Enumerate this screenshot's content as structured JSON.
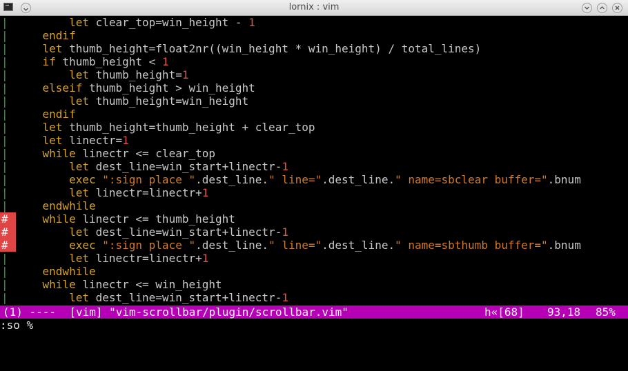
{
  "window": {
    "title": "lornix : vim",
    "app_icon": "terminal-icon",
    "menu_icon": "window-menu-icon",
    "buttons": [
      "minimize-icon",
      "maximize-icon",
      "close-icon"
    ],
    "titlebar_color": "#e6e6e6"
  },
  "editor": {
    "sign_column": [
      "|",
      "|",
      "|",
      "|",
      "|",
      "|",
      "|",
      "|",
      "|",
      "|",
      "|",
      "|",
      "|",
      "|",
      "|",
      "#",
      "#",
      "#",
      "|",
      "|",
      "|",
      "|"
    ],
    "lines": [
      "        let clear_top=win_height - 1",
      "    endif",
      "    let thumb_height=float2nr((win_height * win_height) / total_lines)",
      "    if thumb_height < 1",
      "        let thumb_height=1",
      "    elseif thumb_height > win_height",
      "        let thumb_height=win_height",
      "    endif",
      "    let thumb_height=thumb_height + clear_top",
      "    let linectr=1",
      "    while linectr <= clear_top",
      "        let dest_line=win_start+linectr-1",
      "        exec \":sign place \".dest_line.\" line=\".dest_line.\" name=sbclear buffer=\".bnum",
      "        let linectr=linectr+1",
      "    endwhile",
      "    while linectr <= thumb_height",
      "        let dest_line=win_start+linectr-1",
      "        exec \":sign place \".dest_line.\" line=\".dest_line.\" name=sbthumb buffer=\".bnum",
      "        let linectr=linectr+1",
      "    endwhile",
      "    while linectr <= win_height",
      "        let dest_line=win_start+linectr-1"
    ],
    "colors": {
      "keyword": "#d8a22a",
      "string": "#d07a2a",
      "number": "#d9534f",
      "sign_mark_bg": "#e04545",
      "statusline_bg": "#b600b6"
    }
  },
  "statusline": {
    "left": "(1) ----  [vim] \"vim-scrollbar/plugin/scrollbar.vim\"",
    "hex": "h«[68]",
    "position": "93,18",
    "percent": "85%"
  },
  "commandline": {
    "text": ":so %"
  }
}
